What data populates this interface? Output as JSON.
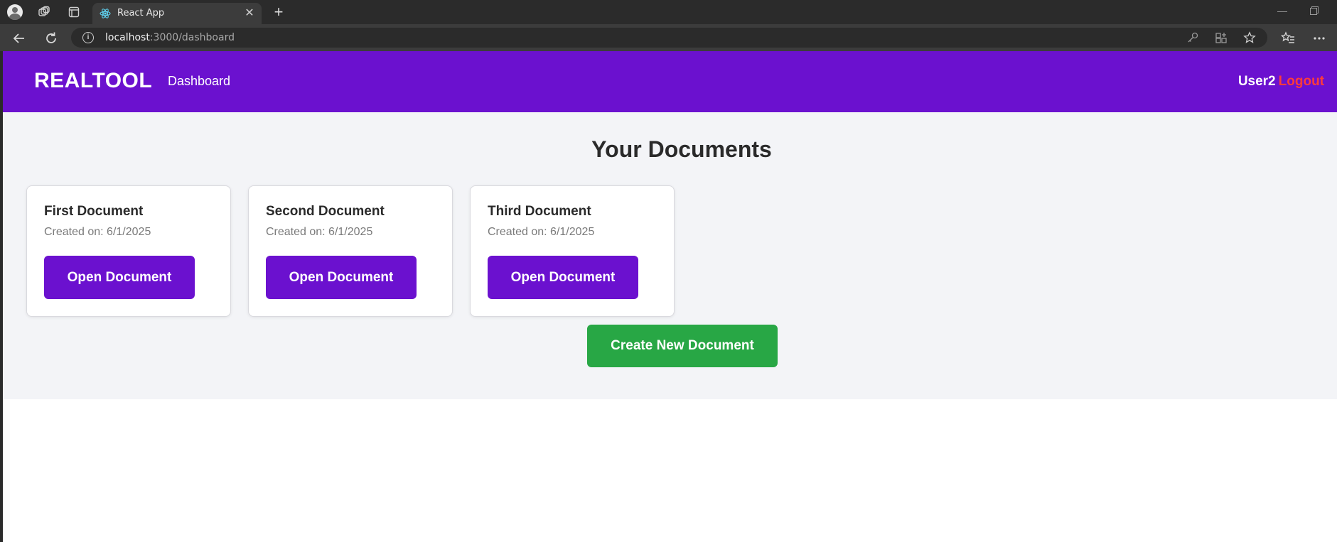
{
  "browser": {
    "tab_title": "React App",
    "url_host": "localhost",
    "url_path": ":3000/dashboard"
  },
  "navbar": {
    "brand": "REALTOOL",
    "link": "Dashboard",
    "username": "User2",
    "logout": "Logout"
  },
  "page": {
    "heading": "Your Documents",
    "create_label": "Create New Document"
  },
  "documents": [
    {
      "title": "First Document",
      "created": "Created on: 6/1/2025",
      "button": "Open Document"
    },
    {
      "title": "Second Document",
      "created": "Created on: 6/1/2025",
      "button": "Open Document"
    },
    {
      "title": "Third Document",
      "created": "Created on: 6/1/2025",
      "button": "Open Document"
    }
  ],
  "colors": {
    "navbar": "#6b11cf",
    "primary_button": "#6b11cf",
    "create_button": "#28a745",
    "logout": "#ff3b3b",
    "page_bg": "#f3f4f7"
  }
}
